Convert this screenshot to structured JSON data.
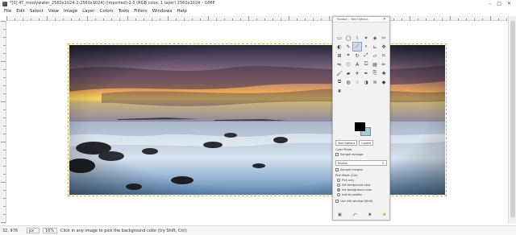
{
  "window": {
    "title": "*[0] 4T_moolywater_2560x1024-2-2560x1024] (imported)-2.0 (RGB color, 1 layer) 2560x1024 – GIMP",
    "controls": [
      "–",
      "□",
      "✕"
    ]
  },
  "menu": [
    "File",
    "Edit",
    "Select",
    "View",
    "Image",
    "Layer",
    "Colors",
    "Tools",
    "Filters",
    "Windows",
    "Help"
  ],
  "toolbox": {
    "title": "Toolbox – Tool Options",
    "close": "✕",
    "tools": [
      {
        "icon": "rect-select-icon",
        "glyph": "▭"
      },
      {
        "icon": "ellipse-select-icon",
        "glyph": "◯"
      },
      {
        "icon": "free-select-icon",
        "glyph": "⌇"
      },
      {
        "icon": "fuzzy-select-icon",
        "glyph": "✶"
      },
      {
        "icon": "color-select-icon",
        "glyph": "◈"
      },
      {
        "icon": "scissors-icon",
        "glyph": "✂"
      },
      {
        "icon": "foreground-select-icon",
        "glyph": "◐"
      },
      {
        "icon": "paths-icon",
        "glyph": "✎"
      },
      {
        "icon": "color-picker-icon",
        "glyph": "⟋"
      },
      {
        "icon": "zoom-icon",
        "glyph": "⌕"
      },
      {
        "icon": "measure-icon",
        "glyph": "⊾"
      },
      {
        "icon": "move-icon",
        "glyph": "✥"
      },
      {
        "icon": "align-icon",
        "glyph": "⊞"
      },
      {
        "icon": "crop-icon",
        "glyph": "⌗"
      },
      {
        "icon": "rotate-icon",
        "glyph": "↻"
      },
      {
        "icon": "scale-icon",
        "glyph": "⤢"
      },
      {
        "icon": "shear-icon",
        "glyph": "▱"
      },
      {
        "icon": "perspective-icon",
        "glyph": "⏢"
      },
      {
        "icon": "flip-icon",
        "glyph": "⇋"
      },
      {
        "icon": "cage-icon",
        "glyph": "⬡"
      },
      {
        "icon": "text-icon",
        "glyph": "A"
      },
      {
        "icon": "bucket-fill-icon",
        "glyph": "⛋"
      },
      {
        "icon": "blend-icon",
        "glyph": "▤"
      },
      {
        "icon": "pencil-icon",
        "glyph": "✏"
      },
      {
        "icon": "paintbrush-icon",
        "glyph": "🖌"
      },
      {
        "icon": "eraser-icon",
        "glyph": "▰"
      },
      {
        "icon": "airbrush-icon",
        "glyph": "✈"
      },
      {
        "icon": "ink-icon",
        "glyph": "✒"
      },
      {
        "icon": "clone-icon",
        "glyph": "⎘"
      },
      {
        "icon": "heal-icon",
        "glyph": "✚"
      },
      {
        "icon": "perspective-clone-icon",
        "glyph": "⧉"
      },
      {
        "icon": "blur-icon",
        "glyph": "◍"
      },
      {
        "icon": "smudge-icon",
        "glyph": "☝"
      },
      {
        "icon": "dodge-burn-icon",
        "glyph": "◑"
      },
      {
        "icon": "warp-icon",
        "glyph": "≋"
      },
      {
        "icon": "handle-icon",
        "glyph": "◆"
      },
      {
        "icon": "mypaint-brush-icon",
        "glyph": "❦"
      }
    ],
    "tabs": [
      "Tool Options",
      "Layers"
    ],
    "options": {
      "tool_name": "Color Picker",
      "sample_average": "Sample average",
      "radius": "Radius",
      "radius_value": "3",
      "sample_merged": "Sample merged",
      "pick_mode_label": "Pick Mode  (Ctrl)",
      "modes": [
        "Pick only",
        "Set foreground color",
        "Set background color",
        "Add to palette"
      ],
      "selected_mode": "Set background color",
      "info_window": "Use info window  (Shift)"
    },
    "bottom_icons": [
      "save-icon",
      "restore-icon",
      "delete-icon",
      "reset-icon"
    ]
  },
  "status": {
    "coords": "32, 976",
    "unit": "px",
    "zoom": "16%",
    "message": "Click in any image to pick the background color (try Shift, Ctrl)"
  },
  "colors": {
    "foreground": "#000000",
    "background": "#a7c7dc",
    "selection_outline": "#c8b53a"
  }
}
